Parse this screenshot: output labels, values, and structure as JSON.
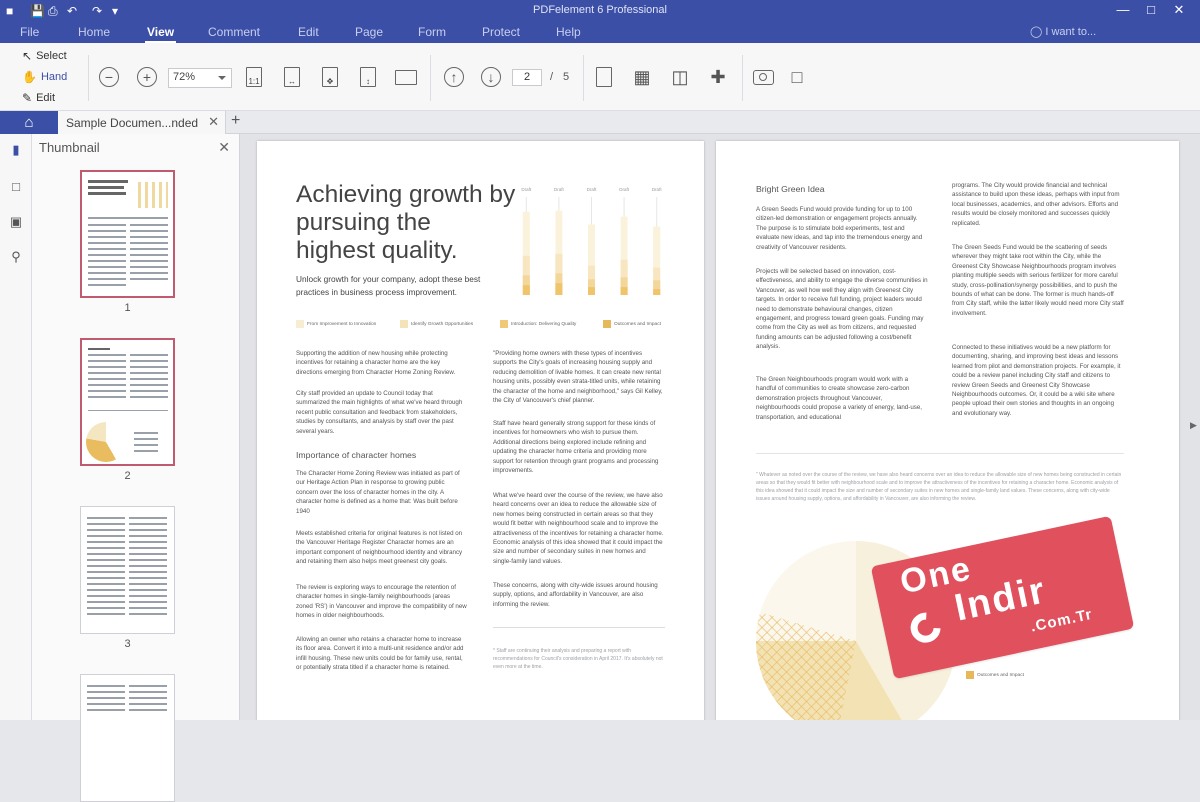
{
  "app": {
    "title": "PDFelement 6 Professional"
  },
  "menu": {
    "items": [
      "File",
      "Home",
      "View",
      "Comment",
      "Edit",
      "Page",
      "Form",
      "Protect",
      "Help"
    ],
    "active": "View",
    "search_placeholder": "I want to..."
  },
  "ribbon": {
    "modes": [
      "Select",
      "Hand",
      "Edit"
    ],
    "zoom": "72%",
    "current_page": "2",
    "page_separator": "/",
    "total_pages": "5"
  },
  "tabs": {
    "document": "Sample Documen...nded"
  },
  "thumbnail_panel": {
    "title": "Thumbnail",
    "pages": [
      "1",
      "2",
      "3"
    ]
  },
  "page_left": {
    "heading": "Achieving growth by pursuing the highest quality.",
    "lead": "Unlock growth for your company, adopt these best practices in business process improvement.",
    "chart_legend": [
      "From Improvement to Innovation",
      "Identify Growth Opportunities",
      "Introduction: Delivering Quality",
      "Outcomes and Impact"
    ],
    "chart_labels": [
      "Draft",
      "Draft",
      "Draft",
      "Draft",
      "Draft"
    ],
    "col1_p1": "Supporting the addition of new housing while protecting incentives for retaining a character home are the key directions emerging from Character Home Zoning Review.",
    "col1_p2": "City staff provided an update to Council today that summarized the main highlights of what we've heard through recent public consultation and feedback from stakeholders, studies by consultants, and analysis by staff over the past several years.",
    "col1_subheading": "Importance of character homes",
    "col1_p3": "The Character Home Zoning Review was initiated as part of our Heritage Action Plan in response to growing public concern over the loss of character homes in the city. A character home is defined as a home that: Was built before 1940",
    "col1_p4": "Meets established criteria for original features is not listed on the Vancouver Heritage Register Character homes are an important component of neighbourhood identity and vibrancy and retaining them also helps meet greenest city goals.",
    "col1_p5": "The review is exploring ways to encourage the retention of character homes in single-family neighbourhoods (areas zoned 'RS') in Vancouver and improve the compatibility of new homes in older neighbourhoods.",
    "col1_p6": "Allowing an owner who retains a character home to increase its floor area. Convert it into a multi-unit residence and/or add infill housing. These new units could be for family use, rental, or potentially strata titled if a character home is retained.",
    "col2_p1": "\"Providing home owners with these types of incentives supports the City's goals of increasing housing supply and reducing demolition of livable homes. It can create new rental housing units, possibly even strata-titled units, while retaining the character of the home and neighborhood,\" says Gil Kelley, the City of Vancouver's chief planner.",
    "col2_p2": "Staff have heard generally strong support for these kinds of incentives for homeowners who wish to pursue them. Additional directions being explored include refining and updating the character home criteria and providing more support for retention through grant programs and processing improvements.",
    "col2_p3": "What we've heard over the course of the review, we have also heard concerns over an idea to reduce the allowable size of new homes being constructed in certain areas so that they would fit better with neighbourhood scale and to improve the attractiveness of the incentives for retaining a character home. Economic analysis of this idea showed that it could impact the size and number of secondary suites in new homes and single-family land values.",
    "col2_p4": "These concerns, along with city-wide issues around housing supply, options, and affordability in Vancouver, are also informing the review.",
    "footnote": "* Staff are continuing their analysis and preparing a report with recommendations for Council's consideration in April 2017. It's absolutely not even more at the time."
  },
  "chart_data": {
    "type": "bar",
    "categories": [
      "Draft",
      "Draft",
      "Draft",
      "Draft",
      "Draft"
    ],
    "series": [
      {
        "name": "From Improvement to Innovation",
        "values": [
          10,
          12,
          8,
          8,
          6
        ]
      },
      {
        "name": "Identify Growth Opportunities",
        "values": [
          20,
          22,
          16,
          18,
          15
        ]
      },
      {
        "name": "Introduction: Delivering Quality",
        "values": [
          40,
          42,
          30,
          36,
          28
        ]
      },
      {
        "name": "Outcomes and Impact",
        "values": [
          85,
          86,
          72,
          80,
          70
        ]
      }
    ],
    "ylim": [
      0,
      100
    ],
    "grid": true
  },
  "page_right": {
    "subheading": "Bright Green Idea",
    "colA_p1": "A Green Seeds Fund would provide funding for up to 100 citizen-led demonstration or engagement projects annually. The purpose is to stimulate bold experiments, test and evaluate new ideas, and tap into the tremendous energy and creativity of Vancouver residents.",
    "colA_p2": "Projects will be selected based on innovation, cost-effectiveness, and ability to engage the diverse communities in Vancouver, as well how well they align with Greenest City targets. In order to receive full funding, project leaders would need to demonstrate behavioural changes, citizen engagement, and progress toward green goals. Funding may come from the City as well as from citizens, and requested funding amounts can be adjusted following a cost/benefit analysis.",
    "colA_p3": "The Green Neighbourhoods program would work with a handful of communities to create showcase zero-carbon demonstration projects throughout Vancouver, neighbourhoods could propose a variety of energy, land-use, transportation, and educational",
    "colB_p1": "programs. The City would provide financial and technical assistance to build upon these ideas, perhaps with input from local businesses, academics, and other advisors. Efforts and results would be closely monitored and successes quickly replicated.",
    "colB_p2": "The Green Seeds Fund would be the scattering of seeds wherever they might take root within the City, while the Greenest City Showcase Neighbourhoods program involves planting multiple seeds with serious fertilizer for more careful study, cross-pollination/synergy possibilities, and to push the bounds of what can be done. The former is much hands-off from City staff, while the latter likely would need more City staff involvement.",
    "colB_p3": "Connected to these initiatives would be a new platform for documenting, sharing, and improving best ideas and lessons learned from pilot and demonstration projects. For example, it could be a review panel including City staff and citizens to review Green Seeds and Greenest City Showcase Neighbourhoods outcomes. Or, it could be a wiki site where people upload their own stories and thoughts in an ongoing and evolutionary way.",
    "quote": "\" Whatever as noted over the course of the review, we have also heard concerns over an idea to reduce the allowable size of new homes being constructed in certain areas so that they would fit better with neighbourhood scale and to improve the attractiveness of the incentives for retaining a character home. Economic analysis of this idea showed that it could impact the size and number of secondary suites in new homes and single-family land values. These concerns, along with city-wide issues around housing supply, options, and affordability in Vancouver, are also informing the review.",
    "pie_legend": [
      "From Improvement to Innovation",
      "Identify Growth Opportunities",
      "Introduction: Delivering Quality",
      "Outcomes and Impact"
    ]
  },
  "watermark": {
    "line1": "One",
    "line2": "Indir",
    "line3": ".Com.Tr"
  },
  "colors": {
    "brand": "#3c4fa6",
    "chart_light": "#f4e3b8",
    "chart_dark": "#e6b85a",
    "selected_thumb": "#c05a6e",
    "watermark": "#e0505d"
  }
}
